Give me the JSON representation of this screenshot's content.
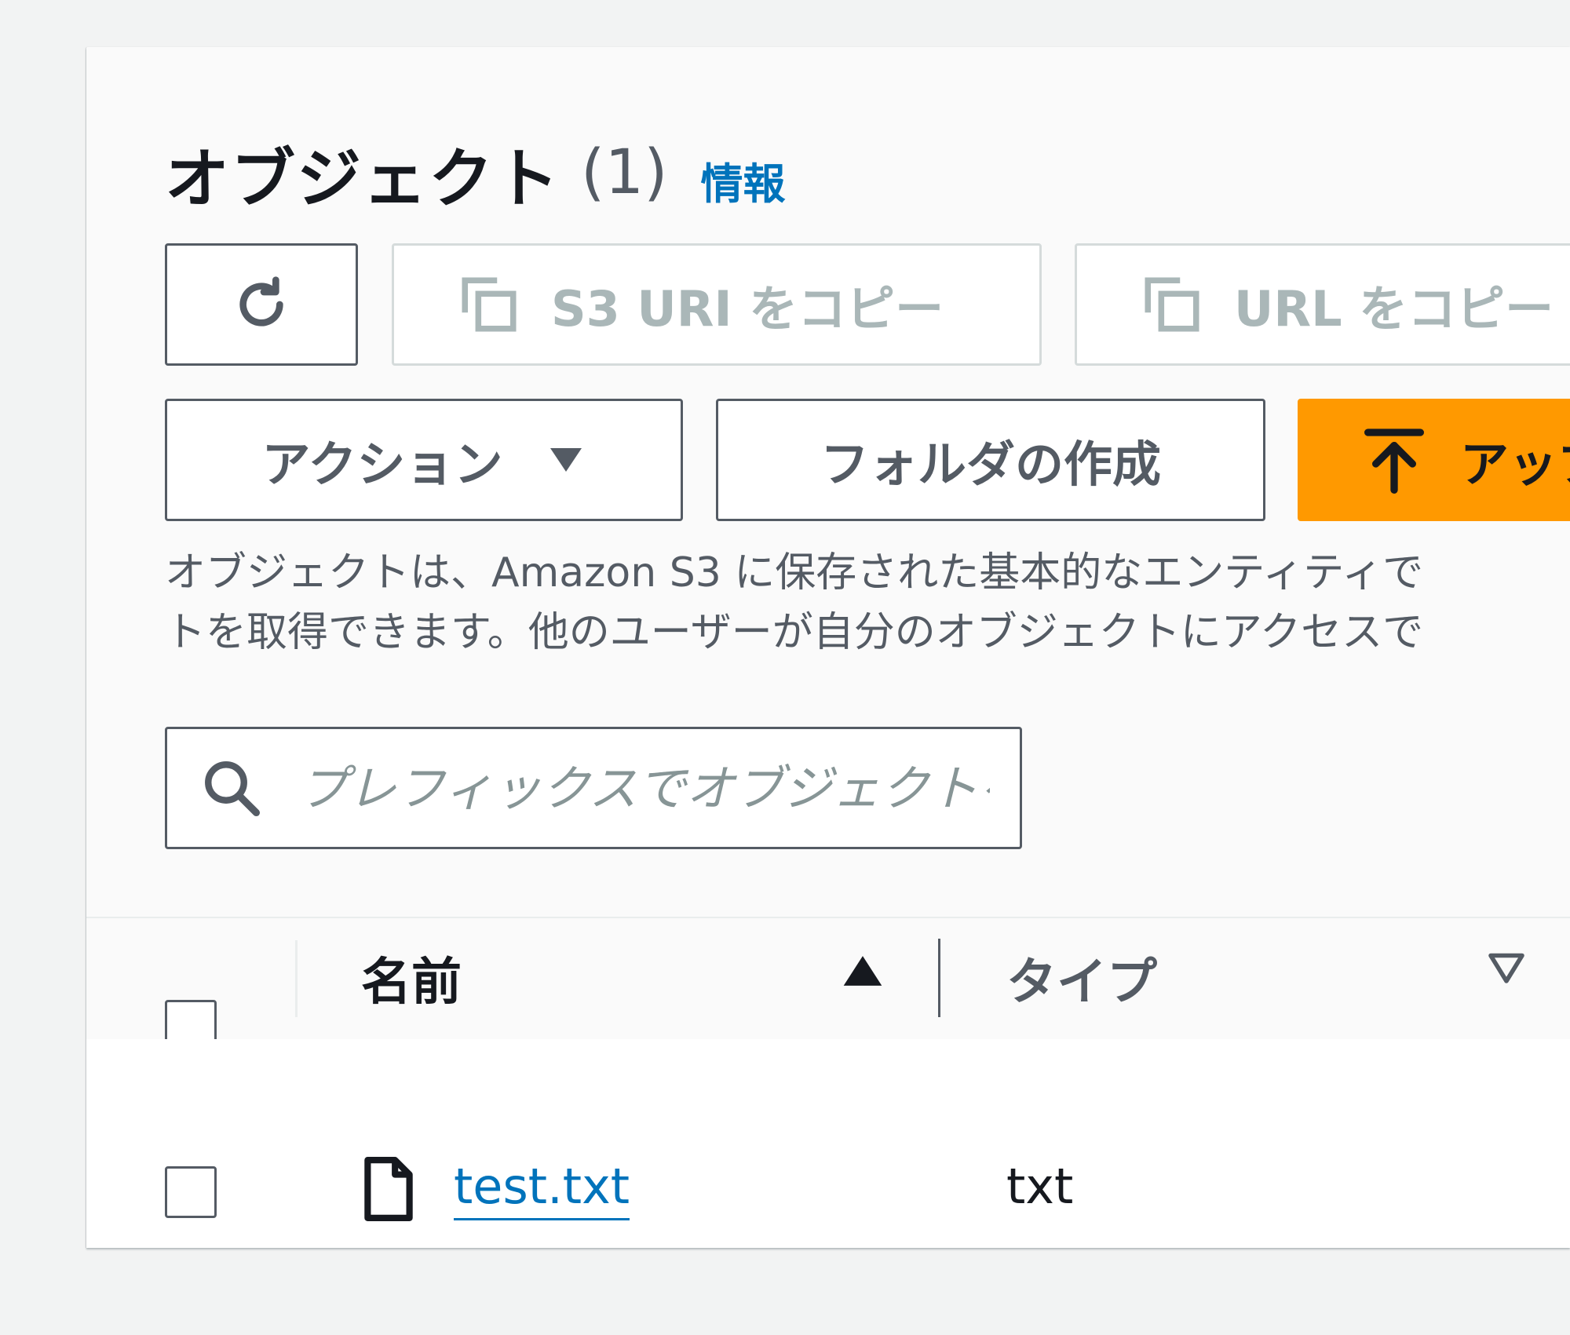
{
  "header": {
    "title": "オブジェクト",
    "count": "(1)",
    "info_link": "情報"
  },
  "toolbar": {
    "refresh_icon": "refresh-icon",
    "copy_s3_uri_label": "S3 URI をコピー",
    "copy_url_label": "URL をコピー",
    "copy_icon": "copy-icon",
    "actions_label": "アクション",
    "create_folder_label": "フォルダの作成",
    "upload_label": "アップロード",
    "upload_icon": "upload-icon"
  },
  "description": {
    "line1": "オブジェクトは、Amazon S3 に保存された基本的なエンティティで",
    "line2": "トを取得できます。他のユーザーが自分のオブジェクトにアクセスで"
  },
  "search": {
    "placeholder": "プレフィックスでオブジェクトを検索"
  },
  "table": {
    "columns": [
      {
        "label": "名前",
        "sort": "ascending"
      },
      {
        "label": "タイプ",
        "sort": "none"
      }
    ],
    "rows": [
      {
        "name": "test.txt",
        "type": "txt",
        "icon": "file-icon"
      }
    ]
  },
  "colors": {
    "accent": "#0073bb",
    "primary_button": "#ff9900",
    "text": "#16191f",
    "secondary_text": "#545b64",
    "disabled_border": "#d5dbdb"
  }
}
